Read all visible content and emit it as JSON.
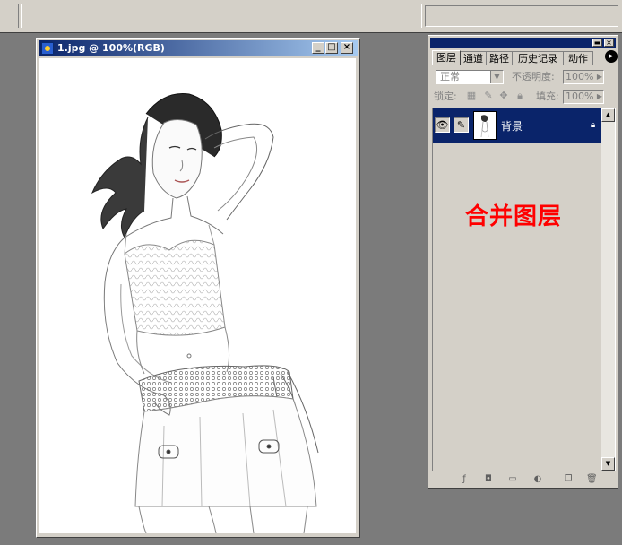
{
  "document": {
    "title": "1.jpg @ 100%(RGB)",
    "minimize": "_",
    "maximize": "□",
    "close": "×"
  },
  "palette": {
    "tabs": [
      {
        "label": "图层",
        "active": true
      },
      {
        "label": "通道",
        "active": false
      },
      {
        "label": "路径",
        "active": false
      },
      {
        "label": "历史记录",
        "active": false
      },
      {
        "label": "动作",
        "active": false
      }
    ],
    "menu_icon": "▸",
    "blend_mode": "正常",
    "opacity_label": "不透明度:",
    "opacity_value": "100%",
    "lock_label": "锁定:",
    "fill_label": "填充:",
    "fill_value": "100%",
    "layers": [
      {
        "name": "背景",
        "visible": true,
        "locked": true,
        "selected": true
      }
    ],
    "annotation": "合并图层"
  },
  "colors": {
    "title_blue": "#0a246a",
    "annotation_red": "#ff0000",
    "workspace": "#7b7b7b",
    "chrome": "#d4d0c8"
  }
}
